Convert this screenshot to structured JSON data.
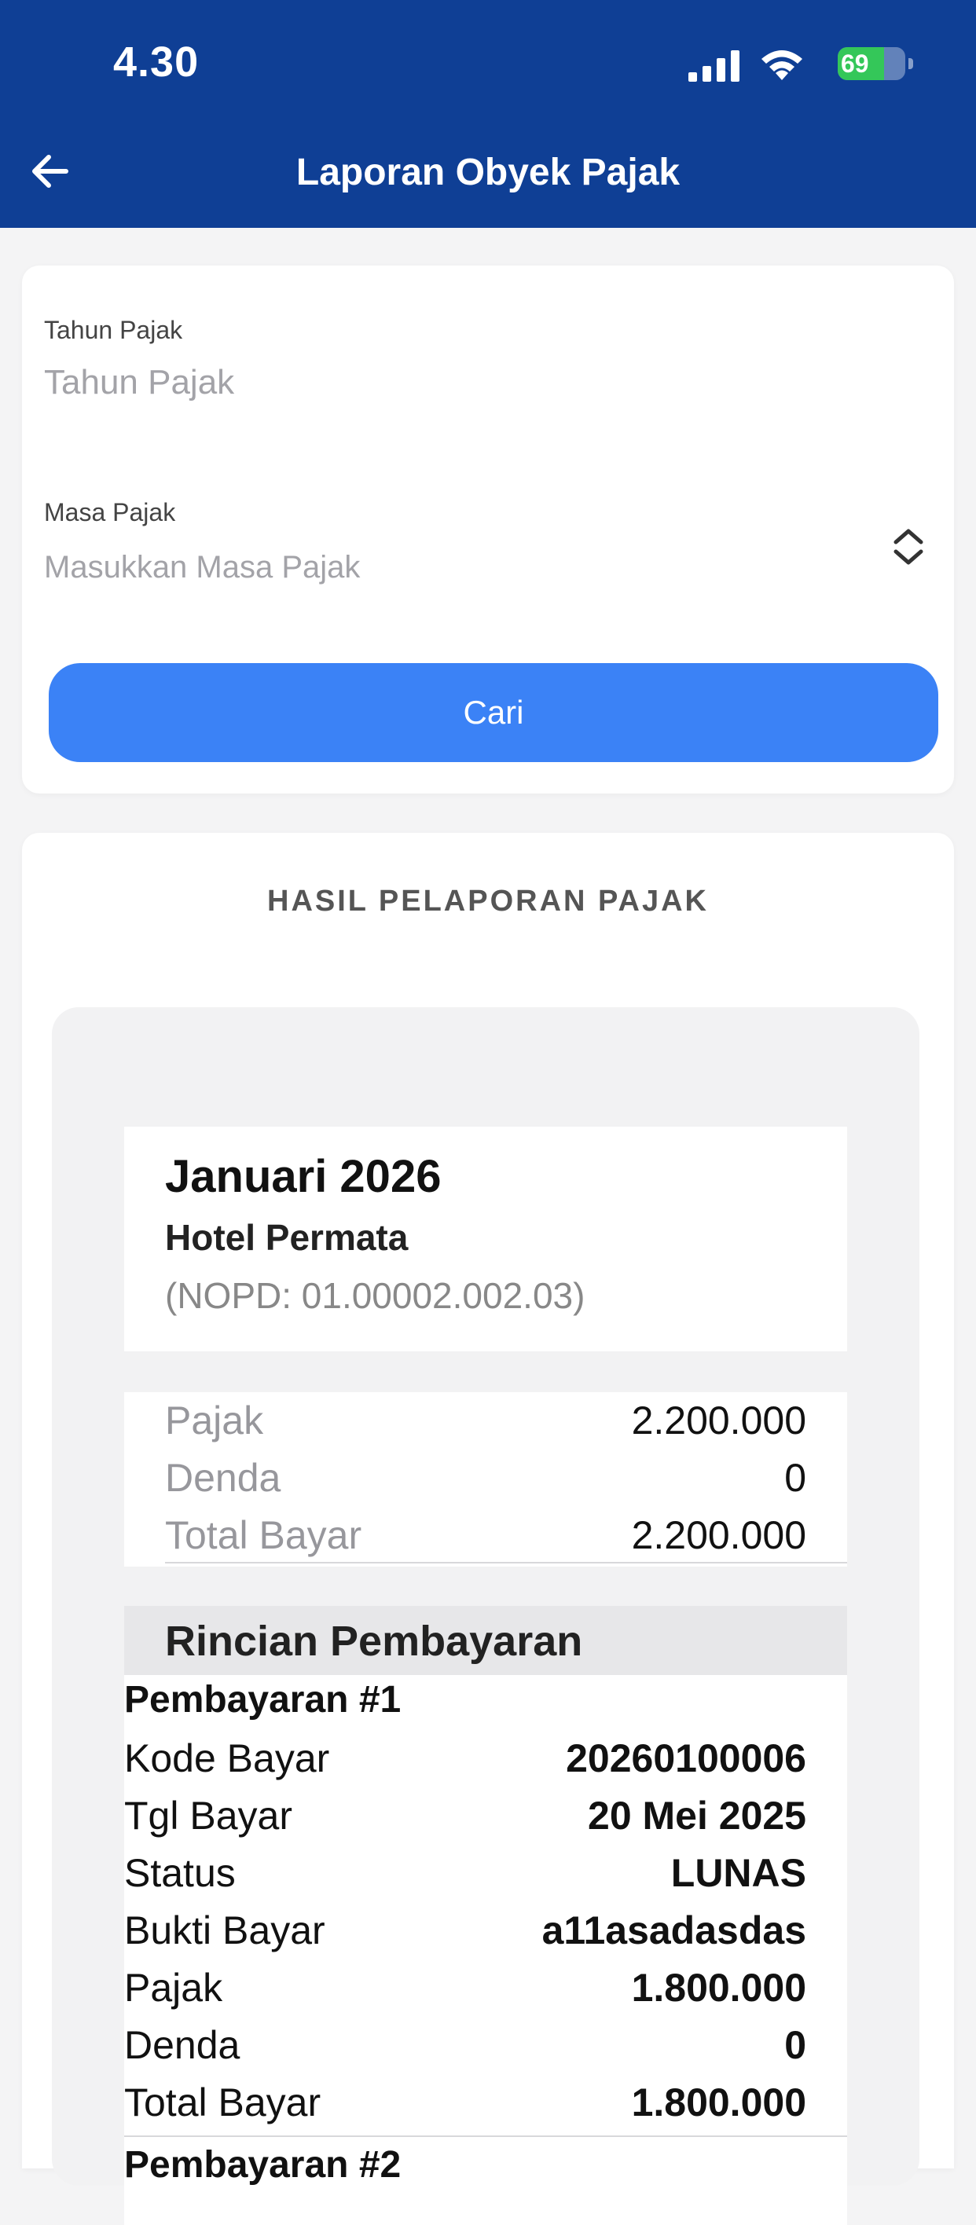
{
  "status_bar": {
    "time": "4.30",
    "battery": "69",
    "battery_level": 0.69
  },
  "header": {
    "title": "Laporan Obyek Pajak"
  },
  "filter": {
    "year_label": "Tahun Pajak",
    "year_placeholder": "Tahun Pajak",
    "period_label": "Masa Pajak",
    "period_placeholder": "Masukkan Masa Pajak",
    "search_label": "Cari"
  },
  "results": {
    "title": "HASIL PELAPORAN PAJAK",
    "period": "Januari 2026",
    "hotel": "Hotel Permata",
    "nopd": "(NOPD: 01.00002.002.03)",
    "summary": [
      {
        "label": "Pajak",
        "value": "2.200.000"
      },
      {
        "label": "Denda",
        "value": "0"
      },
      {
        "label": "Total Bayar",
        "value": "2.200.000"
      }
    ],
    "payments_title": "Rincian Pembayaran",
    "payments": [
      {
        "heading": "Pembayaran #1",
        "rows": [
          {
            "label": "Kode Bayar",
            "value": "20260100006"
          },
          {
            "label": "Tgl Bayar",
            "value": "20 Mei 2025"
          },
          {
            "label": "Status",
            "value": "LUNAS"
          },
          {
            "label": "Bukti Bayar",
            "value": "a11asadasdas"
          },
          {
            "label": "Pajak",
            "value": "1.800.000"
          },
          {
            "label": "Denda",
            "value": "0"
          },
          {
            "label": "Total Bayar",
            "value": "1.800.000"
          }
        ]
      },
      {
        "heading": "Pembayaran #2"
      }
    ]
  }
}
